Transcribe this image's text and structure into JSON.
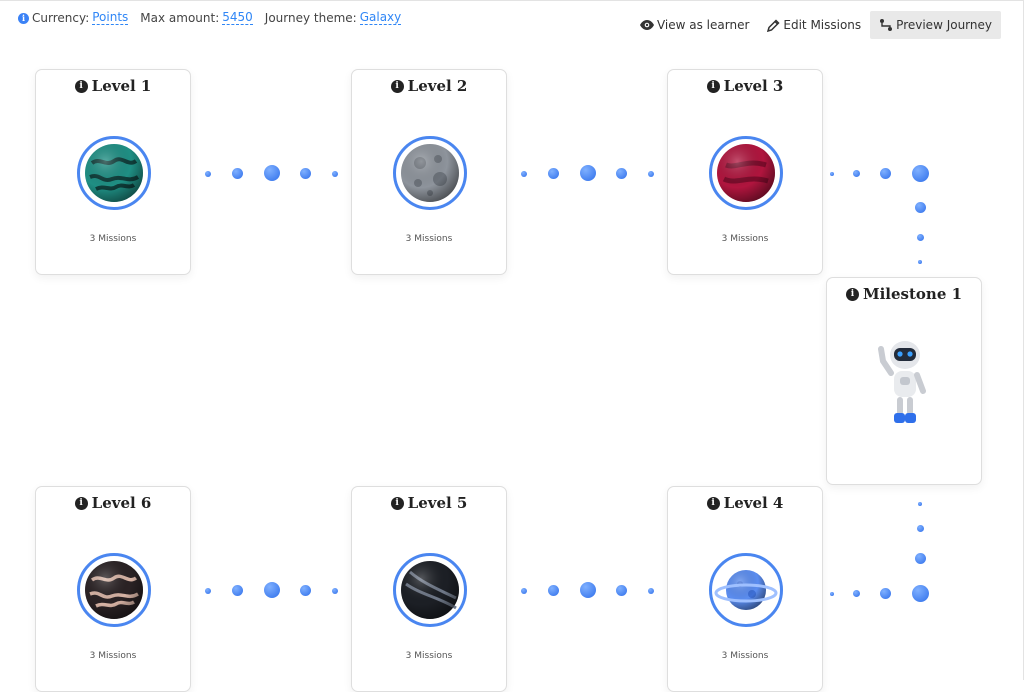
{
  "header": {
    "currency_label": "Currency:",
    "currency_value": "Points",
    "max_amount_label": "Max amount:",
    "max_amount_value": "5450",
    "theme_label": "Journey theme:",
    "theme_value": "Galaxy"
  },
  "actions": {
    "view_as_learner": "View as learner",
    "edit_missions": "Edit Missions",
    "preview_journey": "Preview Journey"
  },
  "levels": [
    {
      "title": "Level 1",
      "missions": "3 Missions",
      "planet": "teal-swirl-planet"
    },
    {
      "title": "Level 2",
      "missions": "3 Missions",
      "planet": "grey-moon-planet"
    },
    {
      "title": "Level 3",
      "missions": "3 Missions",
      "planet": "crimson-planet"
    },
    {
      "title": "Level 4",
      "missions": "3 Missions",
      "planet": "ringed-blue-planet"
    },
    {
      "title": "Level 5",
      "missions": "3 Missions",
      "planet": "black-striped-planet"
    },
    {
      "title": "Level 6",
      "missions": "3 Missions",
      "planet": "dark-swirl-planet"
    }
  ],
  "milestone": {
    "title": "Milestone 1",
    "image": "robot-mascot"
  },
  "colors": {
    "accent": "#2f86f6",
    "ring": "#4a86f0",
    "dot": "#3b7af0"
  }
}
